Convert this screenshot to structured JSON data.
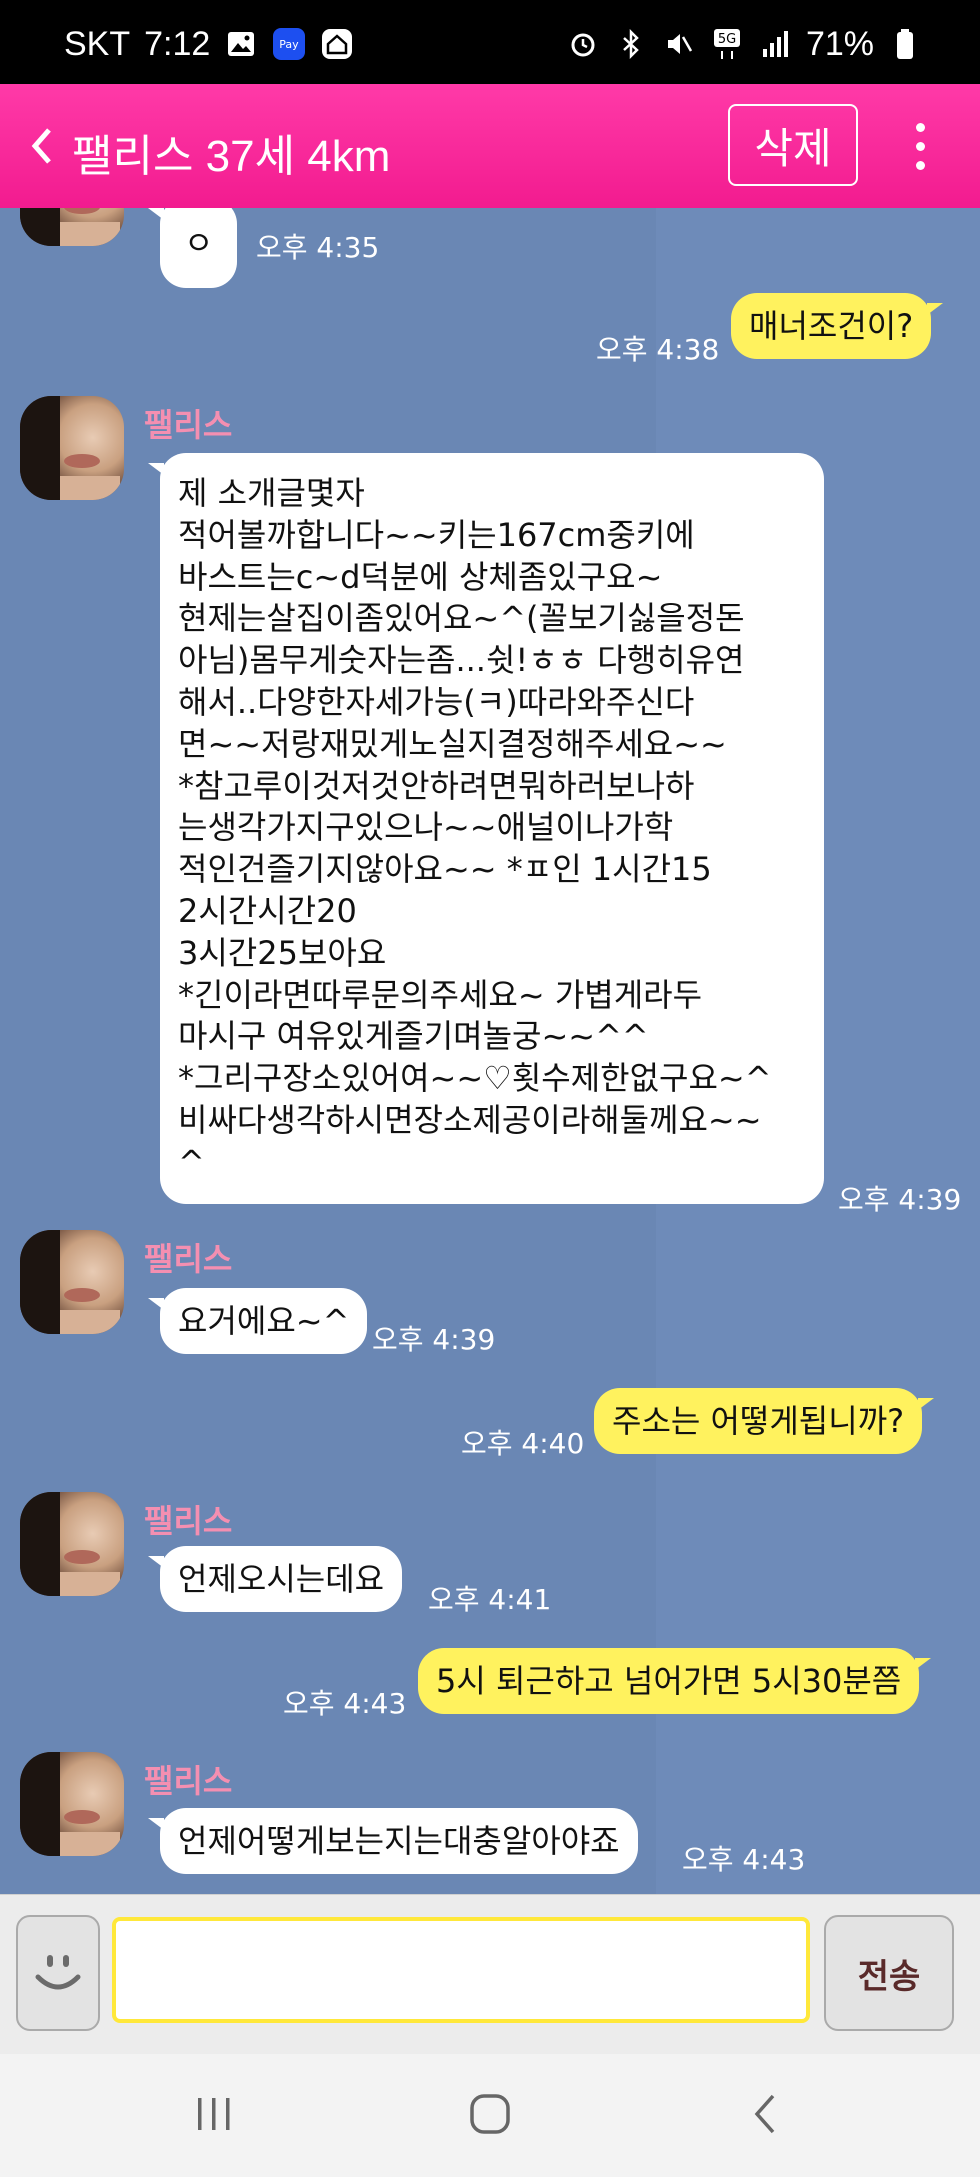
{
  "status_bar": {
    "carrier": "SKT",
    "time": "7:12",
    "battery": "71%",
    "icons": [
      "gallery-icon",
      "samsung-pay-icon",
      "home-icon",
      "alarm-icon",
      "bluetooth-icon",
      "mute-icon",
      "5g-icon",
      "signal-icon",
      "battery-icon"
    ]
  },
  "header": {
    "title": "팰리스 37세 4km",
    "delete_label": "삭제",
    "back_icon": "chevron-left-icon",
    "more_icon": "more-vertical-icon"
  },
  "messages": [
    {
      "from": "them",
      "text": "ㅇ",
      "time": "오후 4:35"
    },
    {
      "from": "me",
      "text": "매너조건이?",
      "time": "오후 4:38"
    },
    {
      "from": "them",
      "name": "팰리스",
      "lines": [
        "제 소개글몇자",
        "적어볼까합니다~~키는167cm중키에",
        "바스트는c~d덕분에 상체좀있구요~",
        "현제는살집이좀있어요~^(꼴보기싫을정돈",
        "아님)몸무게숫자는좀...쉿!ㅎㅎ 다행히유연",
        "해서..다양한자세가능(ㅋ)따라와주신다",
        "면~~저랑재밌게노실지결정해주세요~~",
        "*참고루이것저것안하려면뭐하러보나하",
        "는생각가지구있으나~~애널이나가학",
        "적인건즐기지않아요~~ *ㅍ인 1시간15",
        "2시간시간20",
        "3시간25보아요",
        "*긴이라면따루문의주세요~ 가볍게라두",
        "마시구 여유있게즐기며놀궁~~^^",
        "*그리구장소있어여~~♡횟수제한없구요~^",
        "비싸다생각하시면장소제공이라해둘께요~~",
        "^"
      ],
      "time": "오후 4:39"
    },
    {
      "from": "them",
      "name": "팰리스",
      "text": "요거에요~^",
      "time": "오후 4:39"
    },
    {
      "from": "me",
      "text": "주소는 어떻게됩니까?",
      "time": "오후 4:40"
    },
    {
      "from": "them",
      "name": "팰리스",
      "text": "언제오시는데요",
      "time": "오후 4:41"
    },
    {
      "from": "me",
      "text": "5시 퇴근하고 넘어가면 5시30분쯤",
      "time": "오후 4:43"
    },
    {
      "from": "them",
      "name": "팰리스",
      "text": "언제어떻게보는지는대충알아야죠",
      "time": "오후 4:43"
    }
  ],
  "input": {
    "value": "",
    "placeholder": "",
    "send_label": "전송",
    "emoji_icon": "smiley-icon"
  },
  "nav": {
    "icons": [
      "recent-apps-icon",
      "home-button-icon",
      "back-icon"
    ]
  }
}
